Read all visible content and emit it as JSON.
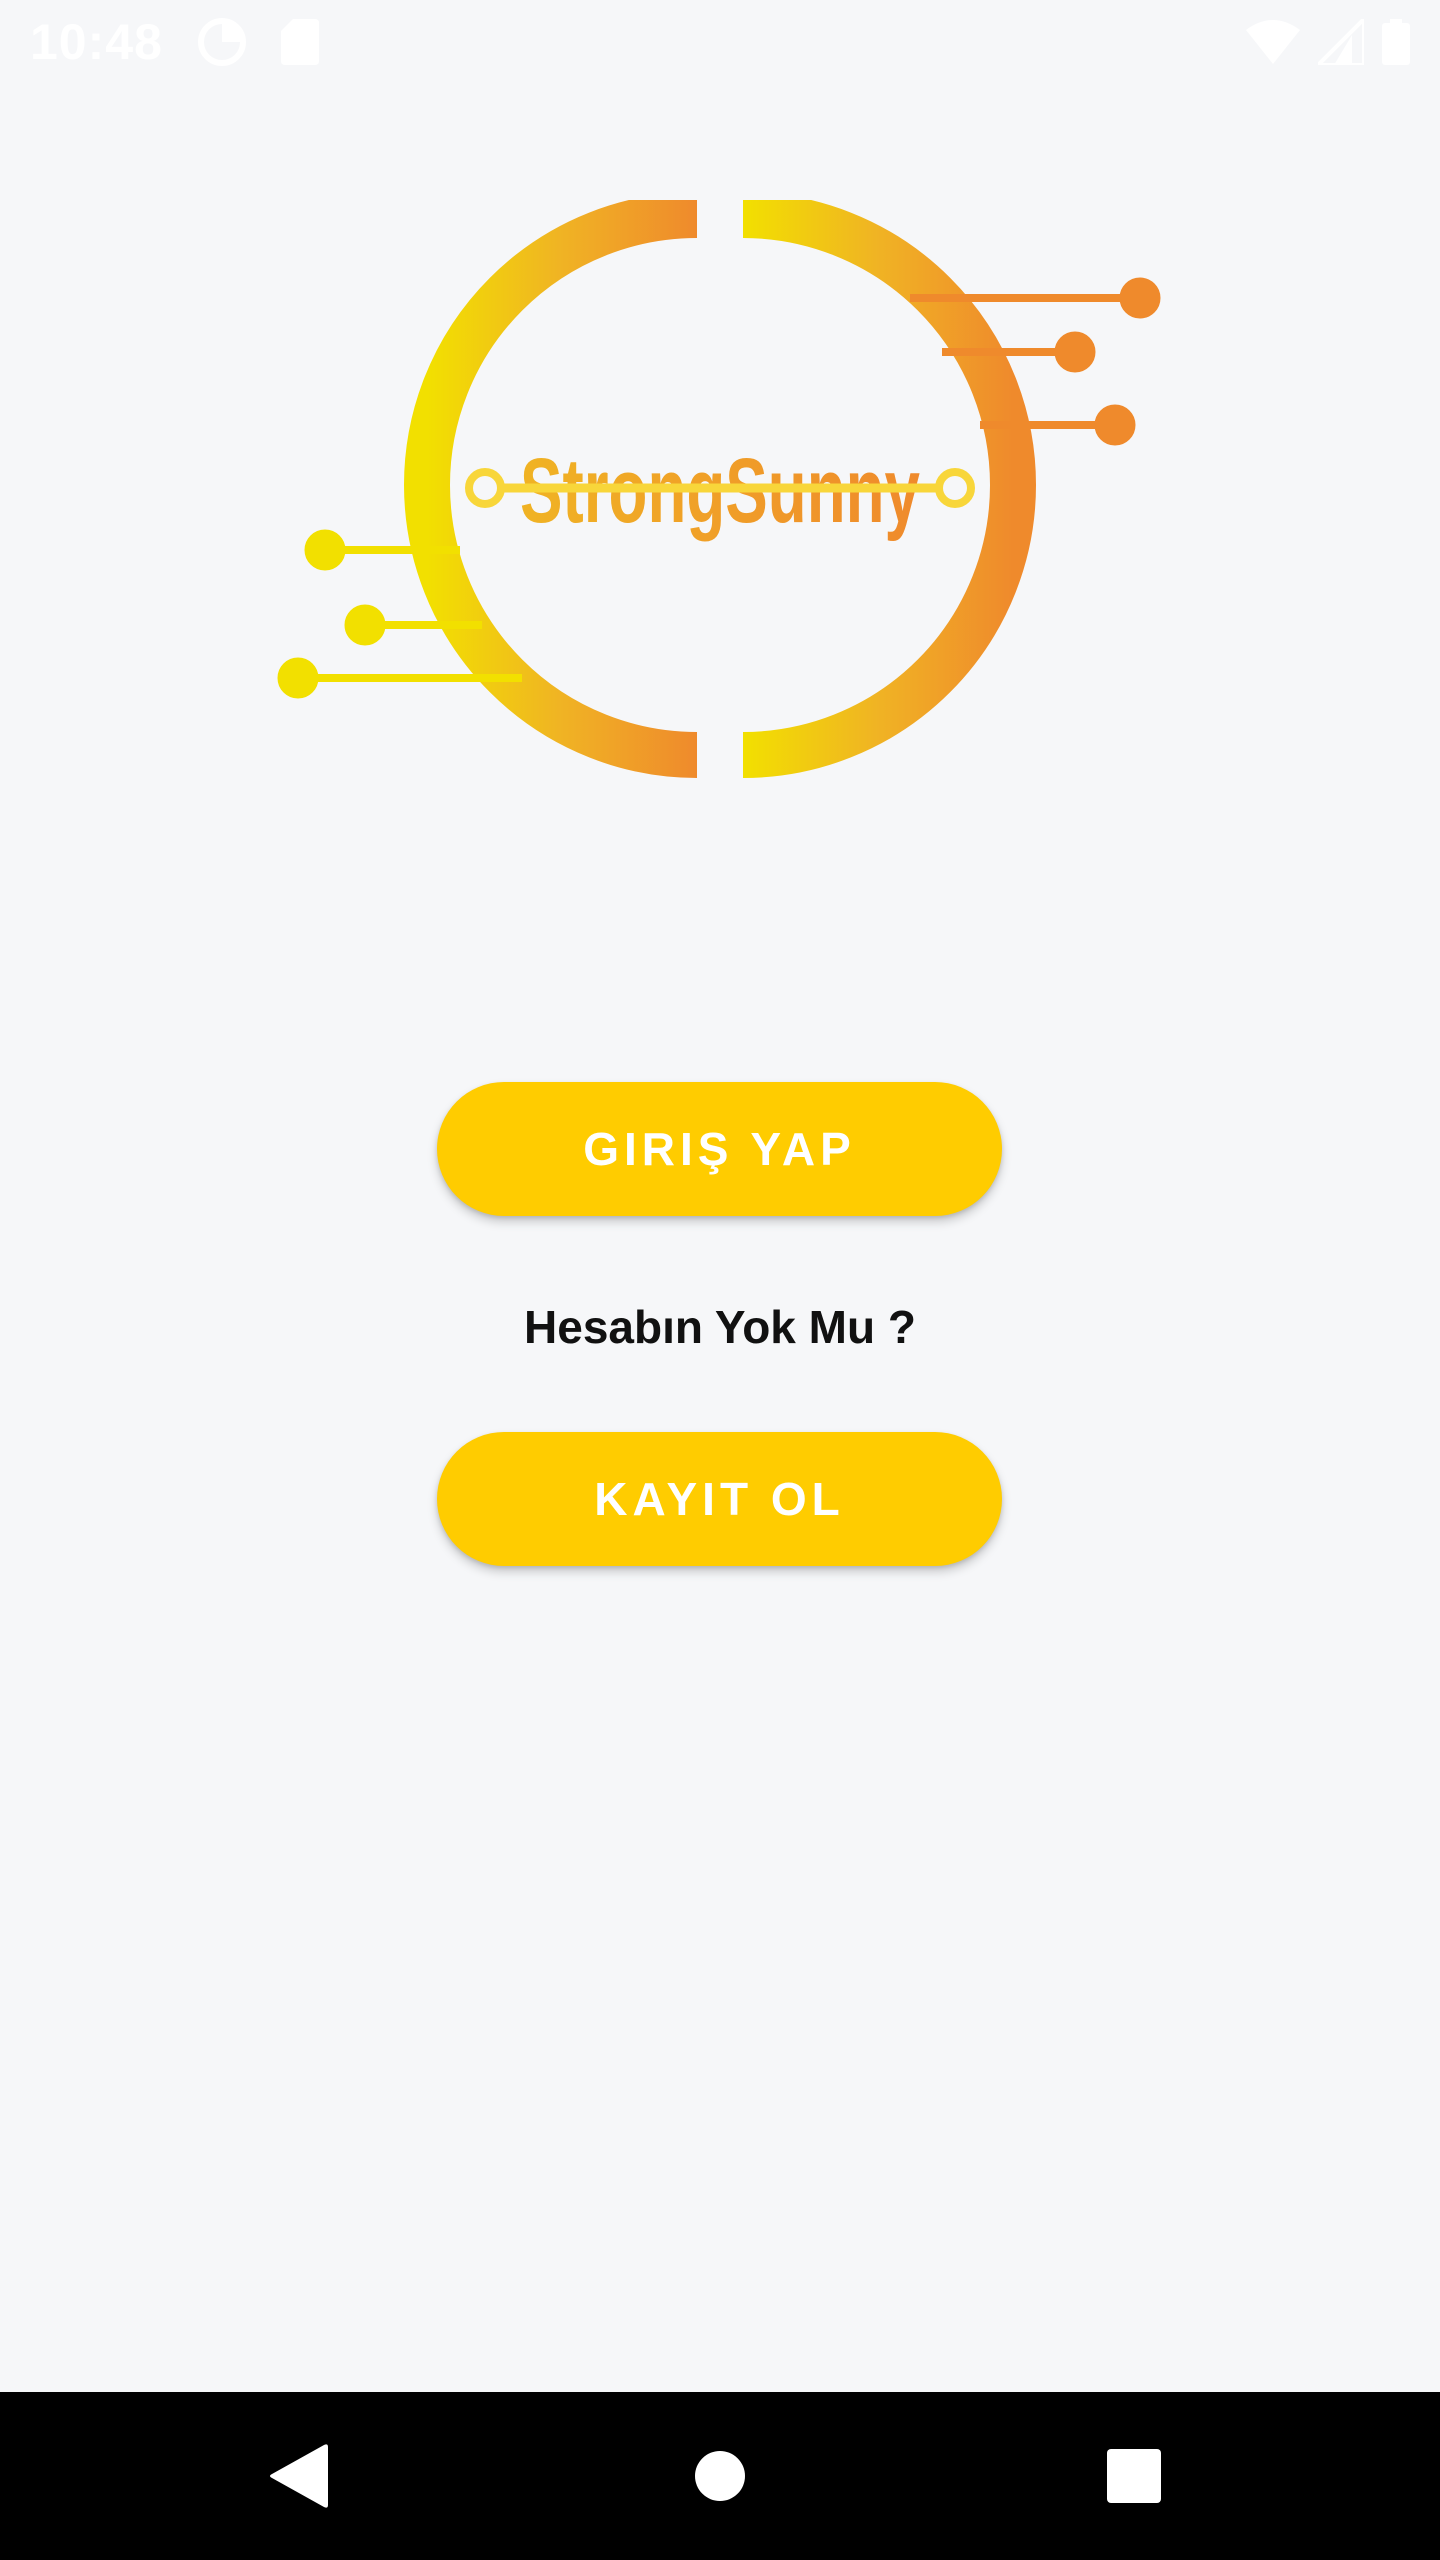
{
  "status_bar": {
    "time": "10:48",
    "left_icons": [
      "data-saver-icon",
      "sd-card-icon"
    ],
    "right_icons": [
      "wifi-icon",
      "cell-signal-icon",
      "battery-icon"
    ]
  },
  "logo": {
    "alt": "StrongSunny",
    "icon": "strongsunny-logo",
    "colors": {
      "yellow": "#f2e000",
      "orange": "#ef8a2c"
    }
  },
  "main": {
    "login_button_label": "GIRIŞ YAP",
    "no_account_text": "Hesabın Yok Mu ?",
    "register_button_label": "KAYIT OL"
  },
  "nav_bar": {
    "icons": [
      "back-icon",
      "home-icon",
      "recents-icon"
    ]
  },
  "colors": {
    "accent": "#ffcc00",
    "background": "#f6f7f9",
    "nav_bar": "#000000"
  }
}
